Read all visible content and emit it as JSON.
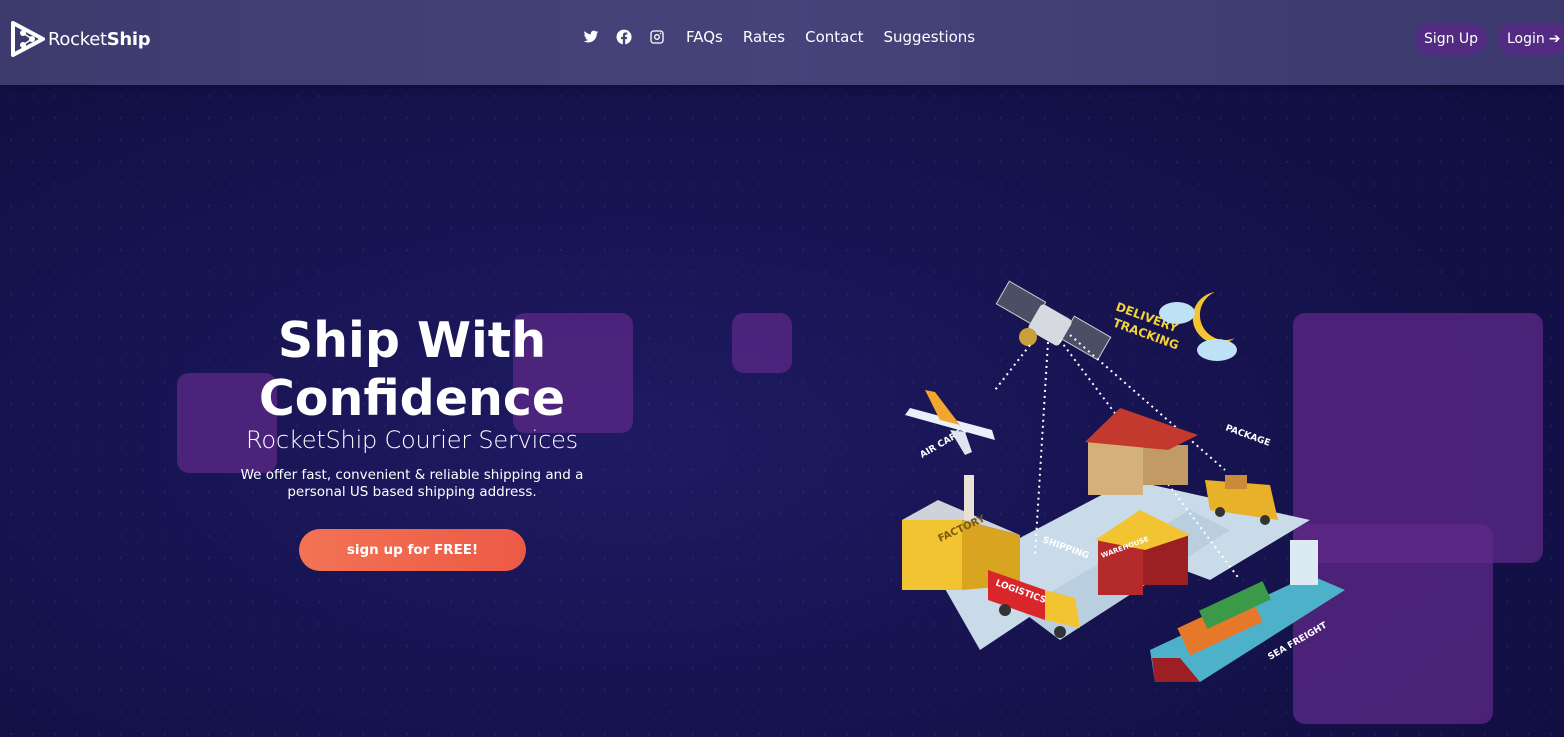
{
  "brand": {
    "name_light": "Rocket",
    "name_bold": "Ship"
  },
  "nav": {
    "social": [
      "twitter-icon",
      "facebook-icon",
      "instagram-icon"
    ],
    "links": [
      "FAQs",
      "Rates",
      "Contact",
      "Suggestions"
    ],
    "signup": "Sign Up",
    "login": "Login"
  },
  "hero": {
    "title_line1": "Ship With",
    "title_line2": "Confidence",
    "subtitle": "RocketShip Courier Services",
    "desc_line1": "We offer fast, convenient & reliable shipping and a",
    "desc_line2": "personal US based shipping address.",
    "cta": "sign up for FREE!"
  },
  "illustration": {
    "labels": {
      "delivery": "DELIVERY",
      "tracking": "TRACKING",
      "air_cargo": "AIR CARGO",
      "package": "PACKAGE",
      "factory": "FACTORY",
      "shipping": "SHIPPING",
      "warehouse": "WAREHOUSE",
      "logistics": "LOGISTICS",
      "sea_freight": "SEA FREIGHT"
    }
  },
  "colors": {
    "background": "#14124a",
    "navbar": "#42407a",
    "pill": "#522c82",
    "cta": "#ef6a50",
    "square": "#5e2887"
  }
}
